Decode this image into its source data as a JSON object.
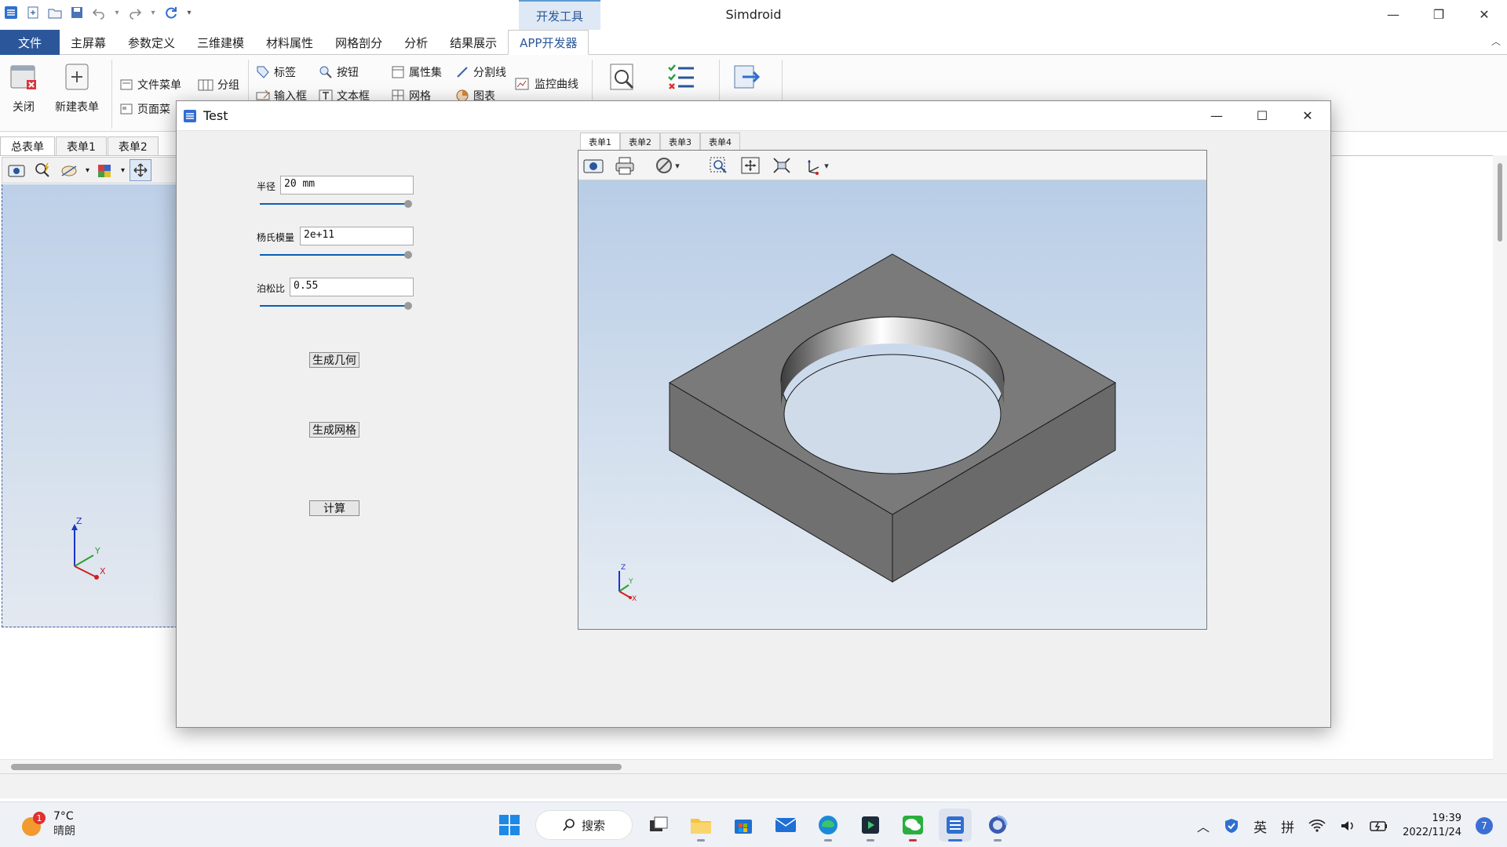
{
  "titlebar": {
    "app_title": "Simdroid",
    "context_tab": "开发工具"
  },
  "ribbon": {
    "tabs": [
      "文件",
      "主屏幕",
      "参数定义",
      "三维建模",
      "材料属性",
      "网格剖分",
      "分析",
      "结果展示",
      "APP开发器"
    ],
    "groups": {
      "close": "关闭",
      "new_form": "新建表单",
      "file_menu": "文件菜单",
      "page_menu": "页面菜",
      "group": "分组",
      "label": "标签",
      "input_box": "输入框",
      "button": "按钮",
      "text_box": "文本框",
      "property_set": "属性集",
      "grid": "网格",
      "divider": "分割线",
      "chart": "图表",
      "monitor_curve": "监控曲线"
    }
  },
  "doc_tabs": [
    "总表单",
    "表单1",
    "表单2"
  ],
  "dialog": {
    "title": "Test",
    "fields": [
      {
        "label": "半径",
        "value": "20 mm"
      },
      {
        "label": "杨氏模量",
        "value": "2e+11"
      },
      {
        "label": "泊松比",
        "value": "0.55"
      }
    ],
    "buttons": {
      "gen_geometry": "生成几何",
      "gen_mesh": "生成网格",
      "compute": "计算"
    },
    "inner_tabs": [
      "表单1",
      "表单2",
      "表单3",
      "表单4"
    ],
    "triad_labels": {
      "x": "X",
      "y": "Y",
      "z": "Z"
    }
  },
  "taskbar": {
    "weather_temp": "7°C",
    "weather_cond": "晴朗",
    "weather_badge": "1",
    "search_label": "搜索",
    "ime_lang": "英",
    "ime_mode": "拼",
    "time": "19:39",
    "date": "2022/11/24",
    "notifications": "7"
  },
  "colors": {
    "accent": "#2b579a",
    "viewport_top": "#b8cde6",
    "viewport_bottom": "#e6ecf3",
    "model_gray": "#7a7a7a"
  }
}
